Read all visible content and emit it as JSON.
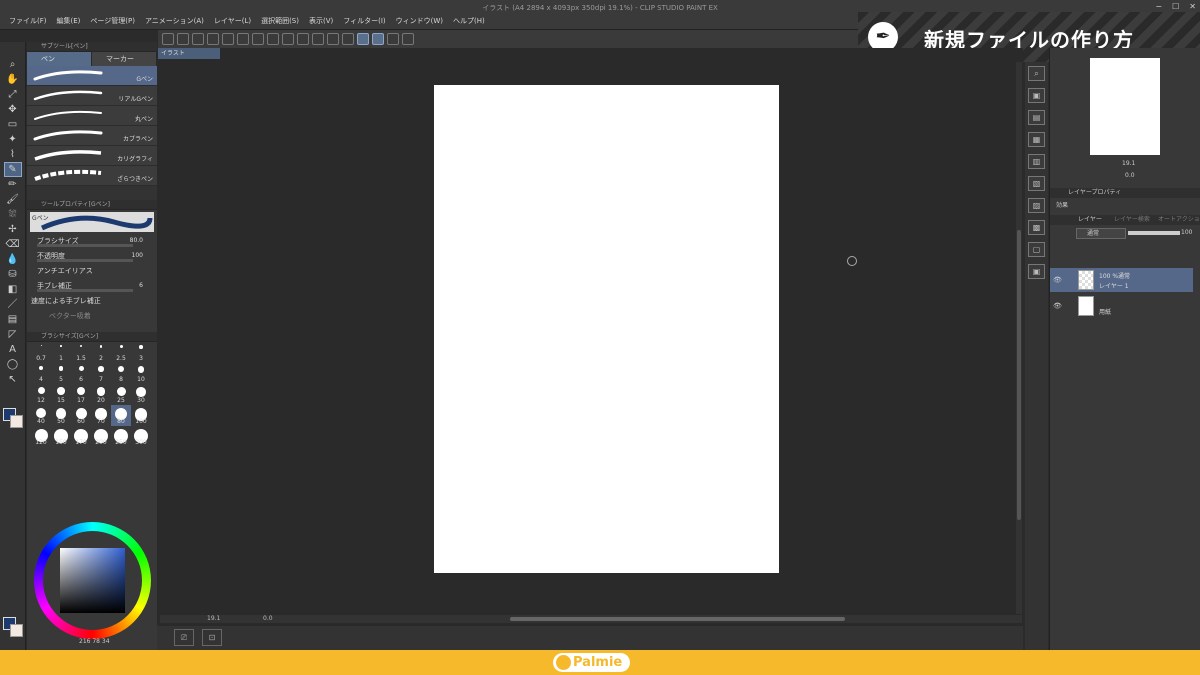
{
  "window": {
    "title": "イラスト (A4 2894 x 4093px 350dpi 19.1%) - CLIP STUDIO PAINT EX",
    "controls": [
      "−",
      "☐",
      "✕"
    ]
  },
  "menu": [
    "ファイル(F)",
    "編集(E)",
    "ページ管理(P)",
    "アニメーション(A)",
    "レイヤー(L)",
    "選択範囲(S)",
    "表示(V)",
    "フィルター(I)",
    "ウィンドウ(W)",
    "ヘルプ(H)"
  ],
  "banner": {
    "text": "新規ファイルの作り方"
  },
  "document_tab": "イラスト",
  "subtool_panel": {
    "header": "サブツール[ペン]",
    "tabs": [
      "ペン",
      "マーカー"
    ],
    "brushes": [
      "Gペン",
      "リアルGペン",
      "丸ペン",
      "カブラペン",
      "カリグラフィ",
      "ざらつきペン"
    ]
  },
  "tool_property": {
    "header": "ツールプロパティ[Gペン]",
    "preview_label": "Gペン",
    "rows": [
      {
        "label": "ブラシサイズ",
        "value": "80.0"
      },
      {
        "label": "不透明度",
        "value": "100"
      },
      {
        "label": "アンチエイリアス",
        "value": ""
      },
      {
        "label": "手ブレ補正",
        "value": "6"
      }
    ],
    "checkbox_label": "速度による手ブレ補正",
    "vector_label": "ベクター吸着"
  },
  "brush_size_panel": {
    "header": "ブラシサイズ[Gペン]",
    "sizes": [
      "0.7",
      "1",
      "1.5",
      "2",
      "2.5",
      "3",
      "4",
      "5",
      "6",
      "7",
      "8",
      "10",
      "12",
      "15",
      "17",
      "20",
      "25",
      "30",
      "40",
      "50",
      "60",
      "70",
      "80",
      "100",
      "120",
      "150",
      "170",
      "200",
      "250",
      "300"
    ],
    "selected": "80"
  },
  "color_panel": {
    "main_color": "#1c3a6e",
    "sub_color": "#f4e9e2",
    "readout": "216  78  34"
  },
  "canvas": {
    "zoom": "19.1",
    "angle": "0.0"
  },
  "navigator": {
    "zoom": "19.1",
    "angle": "0.0"
  },
  "layer_property": {
    "tab": "レイヤープロパティ",
    "effect_label": "効果"
  },
  "layer_panel": {
    "tabs": [
      "レイヤー",
      "レイヤー検索",
      "オートアクション"
    ],
    "blend_mode": "通常",
    "opacity": "100",
    "layers": [
      {
        "status": "100 %通常",
        "name": "レイヤー 1"
      },
      {
        "status": "",
        "name": "用紙"
      }
    ]
  },
  "footer": {
    "logo_text": "Palmie"
  }
}
